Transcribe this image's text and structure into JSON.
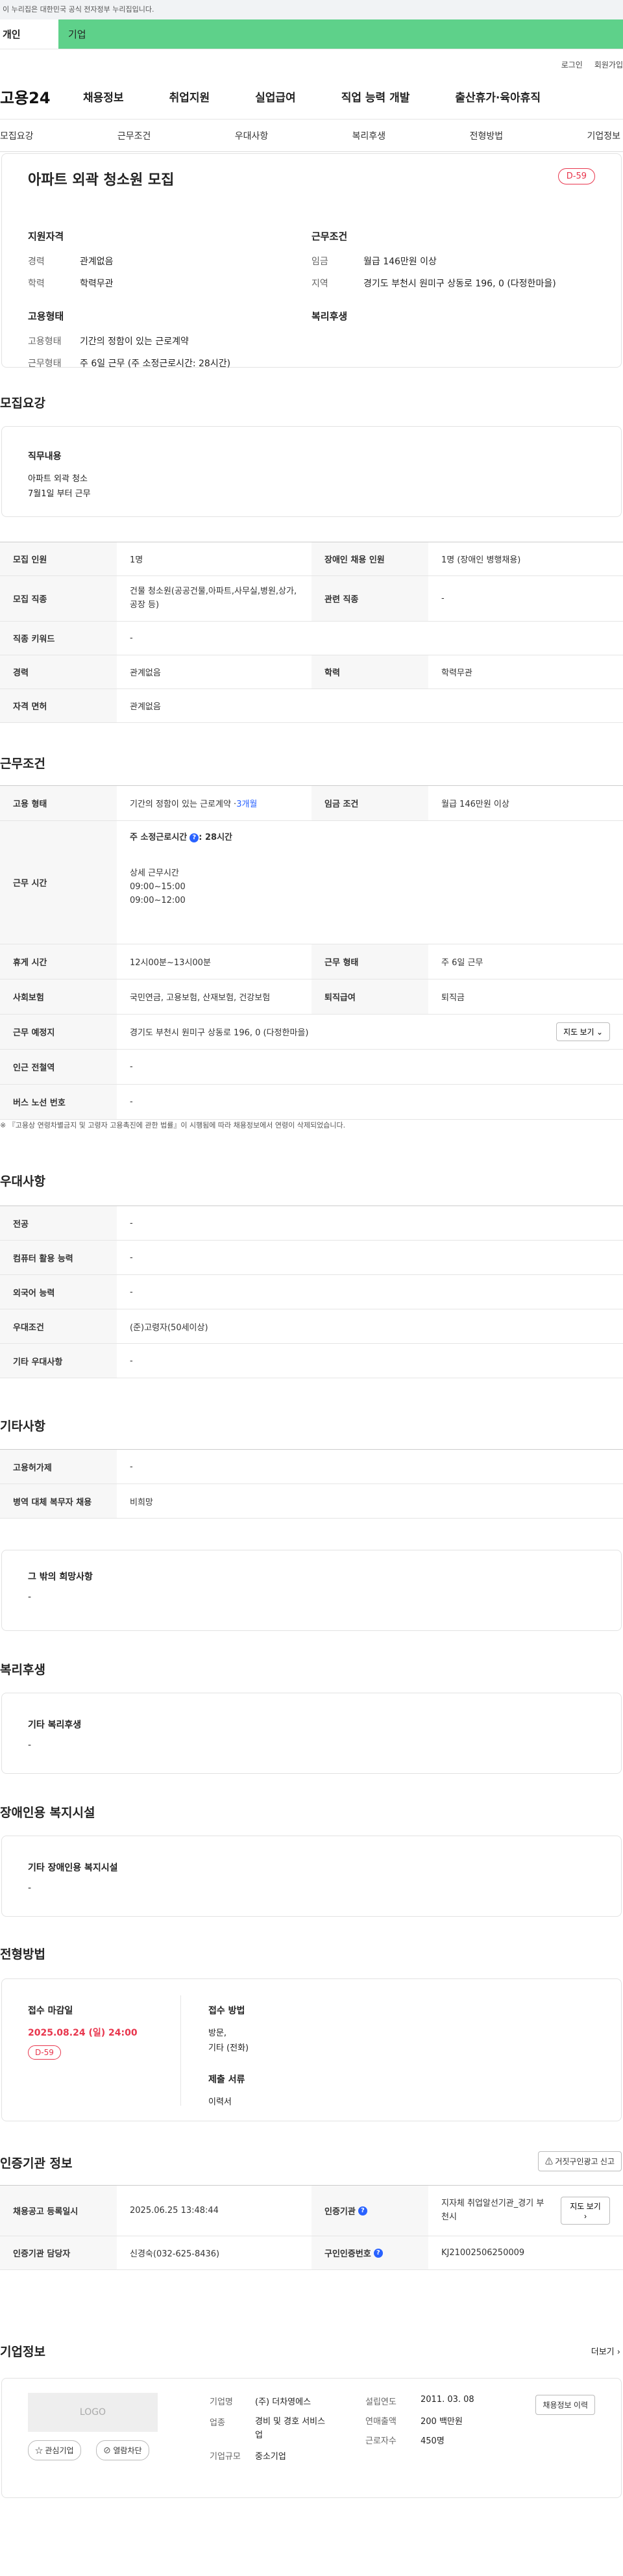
{
  "banner": {
    "text": "이 누리집은 대한민국 공식 전자정부 누리집입니다."
  },
  "user_tabs": {
    "personal": "개인",
    "company": "기업"
  },
  "util": {
    "login": "로그인",
    "join": "회원가입"
  },
  "gnb": {
    "logo": "고용24",
    "items": [
      "채용정보",
      "취업지원",
      "실업급여",
      "직업 능력 개발",
      "출산휴가·육아휴직"
    ]
  },
  "anchors": [
    "모집요강",
    "근무조건",
    "우대사항",
    "복리후생",
    "전형방법",
    "기업정보"
  ],
  "summary": {
    "title": "아파트 외곽 청소원 모집",
    "dday": "D-59",
    "qual_h": "지원자격",
    "career_k": "경력",
    "career_v": "관계없음",
    "edu_k": "학력",
    "edu_v": "학력무관",
    "emp_h": "고용형태",
    "emptype_k": "고용형태",
    "emptype_v": "기간의 정함이 있는 근로계약",
    "worktype_k": "근무형태",
    "worktype_v": "주 6일 근무 (주 소정근로시간: 28시간)",
    "cond_h": "근무조건",
    "wage_k": "임금",
    "wage_v": "월급 146만원 이상",
    "region_k": "지역",
    "region_v": "경기도 부천시 원미구 상동로 196, 0 (다정한마을)",
    "welfare_h": "복리후생"
  },
  "recruit": {
    "title": "모집요강",
    "duty_h": "직무내용",
    "duty_1": "아파트 외곽 청소",
    "duty_2": "7월1일 부터 근무",
    "rows": {
      "count_k": "모집 인원",
      "count_v": "1명",
      "disabled_k": "장애인 채용 인원",
      "disabled_v": "1명 (장애인 병행채용)",
      "job_k": "모집 직종",
      "job_v": "건물 청소원(공공건물,아파트,사무실,병원,상가,공장 등)",
      "rel_k": "관련 직종",
      "rel_v": "-",
      "kw_k": "직종 키워드",
      "kw_v": "-",
      "career_k": "경력",
      "career_v": "관계없음",
      "edu_k": "학력",
      "edu_v": "학력무관",
      "license_k": "자격 면허",
      "license_v": "관계없음"
    }
  },
  "work": {
    "title": "근무조건",
    "type_k": "고용 형태",
    "type_v": "기간의 정함이 있는 근로계약 · ",
    "type_period": "3개월",
    "wage_k": "임금 조건",
    "wage_v": "월급 146만원 이상",
    "hours_k": "근무 시간",
    "hours_main": "주 소정근로시간",
    "hours_val": ": 28시간",
    "hours_detail_h": "상세 근무시간",
    "hours_1": "09:00~15:00",
    "hours_2": "09:00~12:00",
    "rest_k": "휴게 시간",
    "rest_v": "12시00분~13시00분",
    "form_k": "근무 형태",
    "form_v": "주 6일 근무",
    "ins_k": "사회보험",
    "ins_v": "국민연금, 고용보험, 산재보험, 건강보험",
    "sev_k": "퇴직급여",
    "sev_v": "퇴직금",
    "place_k": "근무 예정지",
    "place_v": "경기도 부천시 원미구 상동로 196, 0 (다정한마을)",
    "map_btn": "지도 보기",
    "subway_k": "인근 전철역",
    "subway_v": "-",
    "bus_k": "버스 노선 번호",
    "bus_v": "-",
    "note": "※ 『고용상 연령차별금지 및 고령자 고용촉진에 관한 법률』이 시행됨에 따라 채용정보에서 연령이 삭제되었습니다."
  },
  "pref": {
    "title": "우대사항",
    "major_k": "전공",
    "major_v": "-",
    "pc_k": "컴퓨터 활용 능력",
    "pc_v": "-",
    "lang_k": "외국어 능력",
    "lang_v": "-",
    "cond_k": "우대조건",
    "cond_v": "(준)고령자(50세이상)",
    "etc_k": "기타 우대사항",
    "etc_v": "-"
  },
  "etc": {
    "title": "기타사항",
    "foreign_k": "고용허가제",
    "foreign_v": "-",
    "army_k": "병역 대체 복무자 채용",
    "army_v": "비희망",
    "wish_h": "그 밖의 희망사항",
    "wish_v": "-"
  },
  "welfare": {
    "title": "복리후생",
    "h": "기타 복리후생",
    "v": "-"
  },
  "dis": {
    "title": "장애인용 복지시설",
    "h": "기타 장애인용 복지시설",
    "v": "-"
  },
  "select": {
    "title": "전형방법",
    "deadline_h": "접수 마감일",
    "deadline_v": "2025.08.24 (일) 24:00",
    "dday": "D-59",
    "method_h": "접수 방법",
    "method_1": "방문,",
    "method_2": "기타 (전화)",
    "docs_h": "제출 서류",
    "docs_v": "이력서"
  },
  "agency": {
    "title": "인증기관 정보",
    "report_btn": "거짓구인광고 신고",
    "reg_k": "채용공고 등록일시",
    "reg_v": "2025.06.25 13:48:44",
    "org_k": "인증기관",
    "org_v": "지자체 취업알선기관_경기 부천시",
    "map_btn": "지도 보기",
    "mgr_k": "인증기관 담당자",
    "mgr_v": "신경숙(032-625-8436)",
    "cert_k": "구인인증번호",
    "cert_v": "KJ21002506250009"
  },
  "company": {
    "title": "기업정보",
    "more": "더보기",
    "logo": "LOGO",
    "fav_btn": "관심기업",
    "block_btn": "열람차단",
    "name_k": "기업명",
    "name_v": "(주) 더차영에스",
    "found_k": "설립연도",
    "found_v": "2011. 03. 08",
    "ind_k": "업종",
    "ind_v": "경비 및 경호 서비스업",
    "sales_k": "연매출액",
    "sales_v": "200 백만원",
    "size_k": "기업규모",
    "size_v": "중소기업",
    "emp_k": "근로자수",
    "emp_v": "450명",
    "jobs_btn": "채용정보 이력"
  }
}
